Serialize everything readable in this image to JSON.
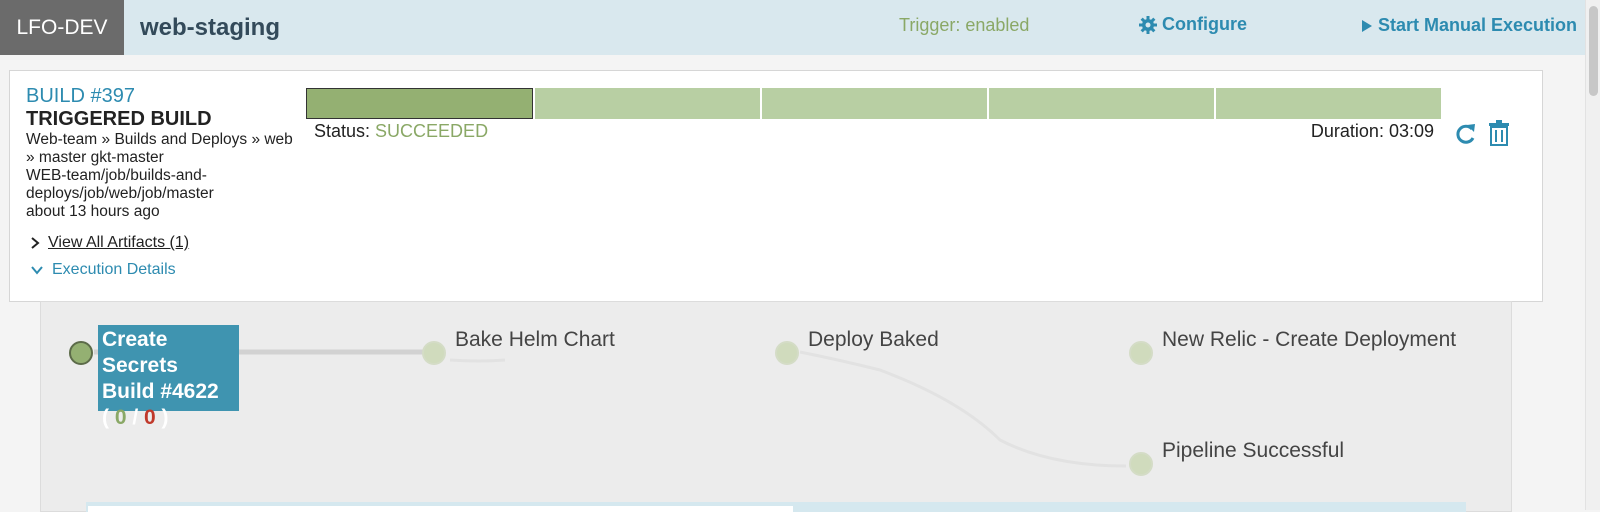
{
  "header": {
    "app": "LFO-DEV",
    "pipeline_name": "web-staging",
    "trigger": "Trigger: enabled",
    "configure": "Configure",
    "start_manual": "Start Manual Execution"
  },
  "build": {
    "link": "BUILD #397",
    "type": "TRIGGERED BUILD",
    "path_lines": [
      "Web-team » Builds and Deploys » web",
      "» master gkt-master",
      "WEB-team/job/builds-and-",
      "deploys/job/web/job/master",
      "about 13 hours ago"
    ],
    "status_label": "Status:",
    "status_value": "SUCCEEDED",
    "duration": "Duration: 03:09",
    "stage_count": 5,
    "active_stage": 0,
    "artifacts": "View All Artifacts (1)",
    "execution_details": "Execution Details"
  },
  "graph": {
    "active_node": {
      "line1": "Create Secrets",
      "line2": "Build #4622",
      "ok": "0",
      "bad": "0"
    },
    "nodes": [
      {
        "label": "Bake Helm Chart"
      },
      {
        "label": "Deploy Baked"
      },
      {
        "label": "New Relic - Create Deployment"
      },
      {
        "label": "Pipeline Successful"
      }
    ]
  },
  "icons": {
    "configure": "gear-icon",
    "start": "play-icon",
    "refresh": "refresh-icon",
    "delete": "trash-icon",
    "artifacts": "chevron-right-icon",
    "details": "chevron-down-icon"
  },
  "colors": {
    "accent": "#2d8bb0",
    "success": "#8aa866",
    "stage": "#b8cfa3",
    "stage_active": "#94b072",
    "node_active": "#3f94b0"
  }
}
